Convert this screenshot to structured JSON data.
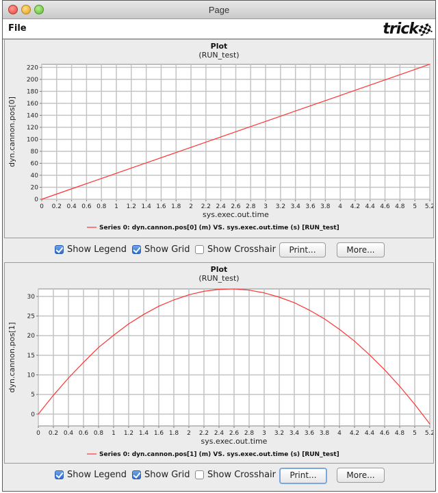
{
  "window": {
    "title": "Page"
  },
  "menu": {
    "file_label": "File",
    "logo_text": "trick"
  },
  "panels": [
    {
      "controls": {
        "show_legend": {
          "label": "Show Legend",
          "checked": true
        },
        "show_grid": {
          "label": "Show Grid",
          "checked": true
        },
        "show_crosshair": {
          "label": "Show Crosshair",
          "checked": false
        },
        "print_label": "Print...",
        "more_label": "More..."
      }
    },
    {
      "controls": {
        "show_legend": {
          "label": "Show Legend",
          "checked": true
        },
        "show_grid": {
          "label": "Show Grid",
          "checked": true
        },
        "show_crosshair": {
          "label": "Show Crosshair",
          "checked": false
        },
        "print_label": "Print...",
        "more_label": "More..."
      }
    }
  ],
  "chart_data": [
    {
      "type": "line",
      "title": "Plot",
      "subtitle": "(RUN_test)",
      "xlabel": "sys.exec.out.time",
      "ylabel": "dyn.cannon.pos[0]",
      "xlim": [
        0,
        5.2
      ],
      "ylim": [
        0,
        225
      ],
      "xticks": [
        0,
        0.2,
        0.4,
        0.6,
        0.8,
        1,
        1.2,
        1.4,
        1.6,
        1.8,
        2,
        2.2,
        2.4,
        2.6,
        2.8,
        3,
        3.2,
        3.4,
        3.6,
        3.8,
        4,
        4.2,
        4.4,
        4.6,
        4.8,
        5,
        5.2
      ],
      "yticks": [
        0,
        20,
        40,
        60,
        80,
        100,
        120,
        140,
        160,
        180,
        200,
        220
      ],
      "grid": true,
      "legend": "bottom-center",
      "series": [
        {
          "name": "Series 0: dyn.cannon.pos[0] (m) VS. sys.exec.out.time (s) [RUN_test]",
          "color": "#ff3333",
          "x": [
            0,
            0.5,
            1,
            1.5,
            2,
            2.5,
            3,
            3.5,
            4,
            4.5,
            5,
            5.2
          ],
          "y": [
            0,
            21.7,
            43.3,
            65.0,
            86.6,
            108.3,
            129.9,
            151.6,
            173.2,
            194.9,
            216.5,
            225.2
          ]
        }
      ]
    },
    {
      "type": "line",
      "title": "Plot",
      "subtitle": "(RUN_test)",
      "xlabel": "sys.exec.out.time",
      "ylabel": "dyn.cannon.pos[1]",
      "xlim": [
        0,
        5.2
      ],
      "ylim": [
        -3,
        31.9
      ],
      "xticks": [
        0,
        0.2,
        0.4,
        0.6,
        0.8,
        1,
        1.2,
        1.4,
        1.6,
        1.8,
        2,
        2.2,
        2.4,
        2.6,
        2.8,
        3,
        3.2,
        3.4,
        3.6,
        3.8,
        4,
        4.2,
        4.4,
        4.6,
        4.8,
        5,
        5.2
      ],
      "yticks": [
        0,
        5,
        10,
        15,
        20,
        25,
        30
      ],
      "grid": true,
      "legend": "bottom-center",
      "series": [
        {
          "name": "Series 0: dyn.cannon.pos[1] (m) VS. sys.exec.out.time (s) [RUN_test]",
          "color": "#ff3333",
          "x": [
            0,
            0.2,
            0.4,
            0.6,
            0.8,
            1,
            1.2,
            1.4,
            1.6,
            1.8,
            2,
            2.2,
            2.4,
            2.6,
            2.8,
            3,
            3.2,
            3.4,
            3.6,
            3.8,
            4,
            4.2,
            4.4,
            4.6,
            4.8,
            5,
            5.2
          ],
          "y": [
            0,
            4.8,
            9.2,
            13.2,
            17.0,
            20.1,
            23.0,
            25.4,
            27.5,
            29.1,
            30.4,
            31.3,
            31.8,
            31.9,
            31.6,
            30.9,
            29.8,
            28.4,
            26.5,
            24.3,
            21.6,
            18.6,
            15.1,
            11.3,
            7.1,
            2.5,
            -2.5
          ]
        }
      ]
    }
  ]
}
